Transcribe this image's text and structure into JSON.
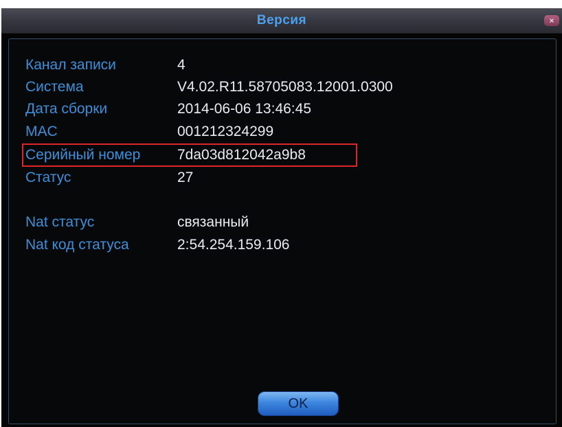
{
  "window": {
    "title": "Версия",
    "close_symbol": "×"
  },
  "info": {
    "rows": [
      {
        "label": "Канал записи",
        "value": "4"
      },
      {
        "label": "Система",
        "value": "V4.02.R11.58705083.12001.0300"
      },
      {
        "label": "Дата сборки",
        "value": "2014-06-06 13:46:45"
      },
      {
        "label": "MAC",
        "value": "001212324299"
      },
      {
        "label": "Серийный номер",
        "value": "7da03d812042a9b8"
      },
      {
        "label": "Статус",
        "value": "27"
      }
    ],
    "nat_rows": [
      {
        "label": "Nat статус",
        "value": "связанный"
      },
      {
        "label": "Nat код статуса",
        "value": "2:54.254.159.106"
      }
    ]
  },
  "footer": {
    "ok_label": "OK"
  },
  "colors": {
    "label": "#3e8fd8",
    "value": "#e9ecf0",
    "title": "#4da0ef",
    "highlight": "#e0252a",
    "ok_button": "#3d86de"
  },
  "icons": {
    "close": "close-icon"
  }
}
